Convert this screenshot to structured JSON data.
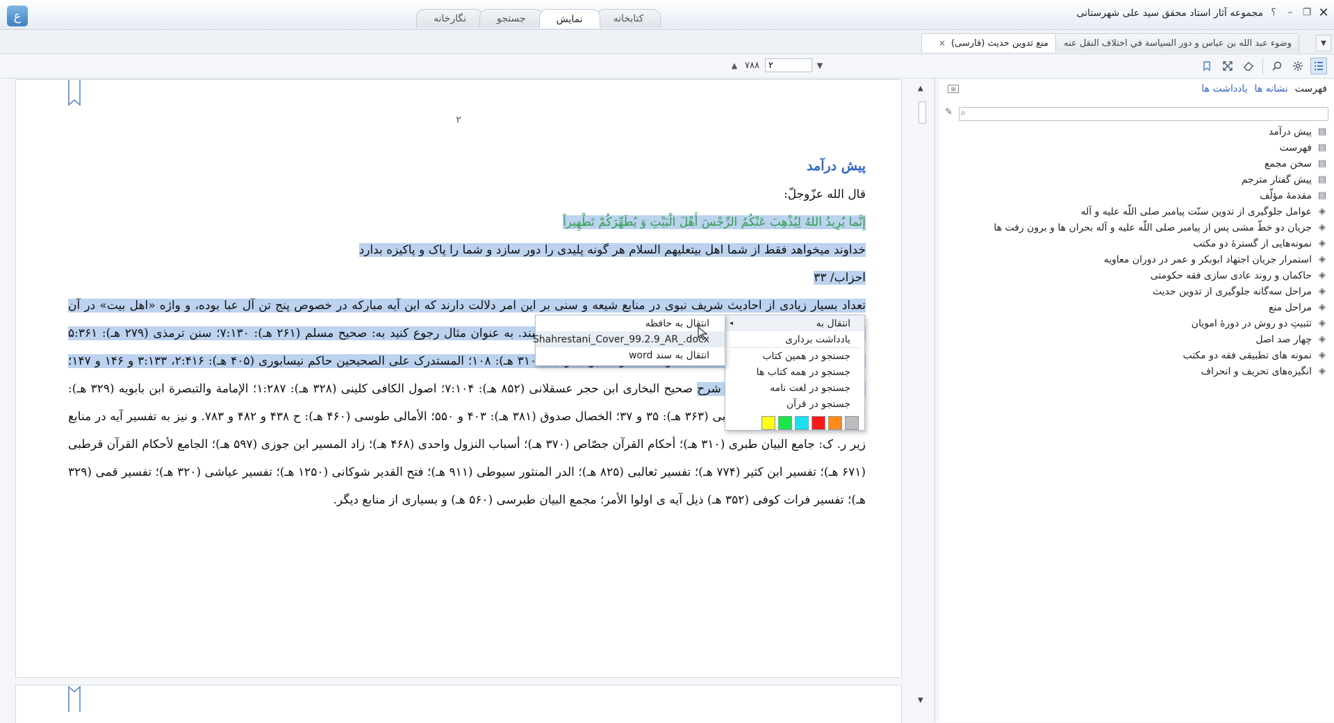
{
  "app": {
    "title": "مجموعه آثار استاد محقق سید علی شهرستانی",
    "logo_glyph": "ع",
    "help_glyph": "؟",
    "minimize_glyph": "–",
    "restore_glyph": "❐",
    "close_glyph": "✕"
  },
  "main_tabs": [
    {
      "label": "کتابخانه",
      "active": false
    },
    {
      "label": "نمایش",
      "active": true
    },
    {
      "label": "جستجو",
      "active": false
    },
    {
      "label": "نگارخانه",
      "active": false
    }
  ],
  "doc_tabs": [
    {
      "label": "وضوء عبد الله بن عباس و دور السياسة في اختلاف النقل عنه",
      "active": false
    },
    {
      "label": "منع تدوین حدیث (فارسی)",
      "active": true,
      "close": "×"
    }
  ],
  "toolbar": {
    "current_page": "۲",
    "total_pages": "۷۸۸",
    "icons": [
      "toc-icon",
      "settings-icon",
      "search-icon",
      "eraser-icon",
      "fullscreen-icon",
      "bookmark-icon"
    ]
  },
  "document": {
    "page_number": "۲",
    "heading": "پیش درآمد",
    "intro": "قال الله عزّوجلّ:",
    "verse": "إِنَّما يُرِيدُ اللهُ لِيُذْهِبَ عَنْكُمُ الرِّجْسَ أَهْلَ الْبَيْتِ وَ يُطَهِّرَكُمْ تَطْهِيراً",
    "translation": "خداوند میخواهد فقط از شما اهل بیتعلیهم السلام هر گونه پلیدی را دور سازد و شما را پاک و پاکیزه بدارد",
    "reference": "احزاب/ ۳۳",
    "para_selected": "تعداد بسیار زیادی از احادیث شریف نبوی در منابع شیعه و سنی بر این امر دلالت دارند که این آیه مبارکه در خصوص پنج تن آل عبا بوده، و واژه «اهل بیت» در آن مخصوص پیامبر، علی، فاطمه، حسن و حسینعلیهم السلامی می باشند. به عنوان مثال رجوع کنید به: صحیح مسلم (۲۶۱ هـ): ۷:۱۳۰؛ سنن ترمذی (۲۷۹ هـ): ۵:۳۶۱ و...؛ السنن الکبری نسائی (۳۰۳ هـ)؛ الذرية الطاهرة النبوية دولابی (۳۱۰ هـ): ۱۰۸؛ المستدرک علی الصحیحین حاکم نیسابوری (۴۰۵ هـ): ۲:۴۱۶، ۳:۱۳۳ و ۱۴۶ و ۱۴۷؛ مسند احمد: ۱۹۷؛ فتح الباری شرح",
    "para_rest": "صحیح البخاری ابن حجر عسقلانی (۸۵۲ هـ): ۷:۱۰۴؛ اصول الکافی کلینی (۳۲۸ هـ): ۱:۲۸۷؛ الإمامة والتبصرة ابن بابویه (۳۲۹ هـ): ۴۷، ح ۲۹؛ دعائم الاسلام مغربی (۳۶۳ هـ): ۳۵ و ۳۷؛ الخصال صدوق (۳۸۱ هـ): ۴۰۳ و ۵۵۰؛ الأمالی طوسی (۴۶۰ هـ): ح ۴۳۸ و ۴۸۲ و ۷۸۳. و نیز به تفسیر آیه در منابع زیر ر. ک: جامع البیان طبری (۳۱۰ هـ)؛ أحکام القرآن جصّاص (۳۷۰ هـ)؛ أسباب النزول واحدی (۴۶۸ هـ)؛ زاد المسیر ابن جوزی (۵۹۷ هـ)؛ الجامع لأحکام القرآن قرطبی (۶۷۱ هـ)؛ تفسیر ابن کثیر (۷۷۴ هـ)؛ تفسیر ثعالبی (۸۲۵ هـ)؛ الدر المنثور سیوطی (۹۱۱ هـ)؛ فتح القدیر شوکانی (۱۲۵۰ هـ)؛ تفسیر عیاشی (۳۲۰ هـ)؛ تفسیر قمی (۳۲۹ هـ)؛ تفسیر فرات کوفی (۳۵۲ هـ) ذیل آیه ی اولوا الأمر؛ مجمع البیان طبرسی (۵۶۰ هـ) و بسیاری از منابع دیگر."
  },
  "side_panel": {
    "tabs": [
      {
        "label": "فهرست",
        "active": true
      },
      {
        "label": "نشانه ها",
        "active": false
      },
      {
        "label": "یادداشت ها",
        "active": false
      }
    ],
    "search_placeholder": "",
    "toc": [
      {
        "label": "پیش درآمد",
        "icon": "page-icon"
      },
      {
        "label": "فهرست",
        "icon": "page-icon"
      },
      {
        "label": "سخن مجمع",
        "icon": "page-icon"
      },
      {
        "label": "پیش گفتار مترجم",
        "icon": "page-icon"
      },
      {
        "label": "مقدمهٔ مؤلّف",
        "icon": "page-icon"
      },
      {
        "label": "عوامل جلوگیری از تدوین سنّت پیامبر صلی اللّه علیه و آله",
        "icon": "folder-icon"
      },
      {
        "label": "جریان دو خطّ مشی پس از پیامبر صلی اللّه علیه و آله بحران ها و برون رفت ها",
        "icon": "folder-icon"
      },
      {
        "label": "نمونه‌هایی از گسترهٔ دو مکتب",
        "icon": "folder-icon"
      },
      {
        "label": "استمرار جریان اجتهاد ابوبکر و عمر در دوران معاویه",
        "icon": "folder-icon"
      },
      {
        "label": "حاکمان و روند عادی سازی فقه حکومتی",
        "icon": "folder-icon"
      },
      {
        "label": "مراحل سه‌گانه جلوگیری از تدوین حدیث",
        "icon": "folder-icon"
      },
      {
        "label": "مراحل منع",
        "icon": "folder-icon"
      },
      {
        "label": "تثبیتِ دو روش در دورهٔ امویان",
        "icon": "folder-icon"
      },
      {
        "label": "چهار صد اصل",
        "icon": "folder-icon"
      },
      {
        "label": "نمونه های تطبیقی فقه دو مکتب",
        "icon": "folder-icon"
      },
      {
        "label": "انگیزه‌های تحریف و انحراف",
        "icon": "folder-icon"
      }
    ]
  },
  "context_menu": {
    "items": [
      "انتقال به",
      "یادداشت برداری",
      "جستجو در همین کتاب",
      "جستجو در همه کتاب ها",
      "جستجو در لغت نامه",
      "جستجو در قرآن"
    ],
    "submenu_arrow": "◂",
    "highlight_colors": [
      "#bdbdbd",
      "#ff8a1a",
      "#ff1a1a",
      "#1ae0f0",
      "#19e64a",
      "#ffff1a"
    ]
  },
  "submenu": {
    "items": [
      "انتقال به حافظه",
      "Shahrestani_Cover_99.2.9_AR_.docx",
      "انتقال به سند word"
    ]
  }
}
